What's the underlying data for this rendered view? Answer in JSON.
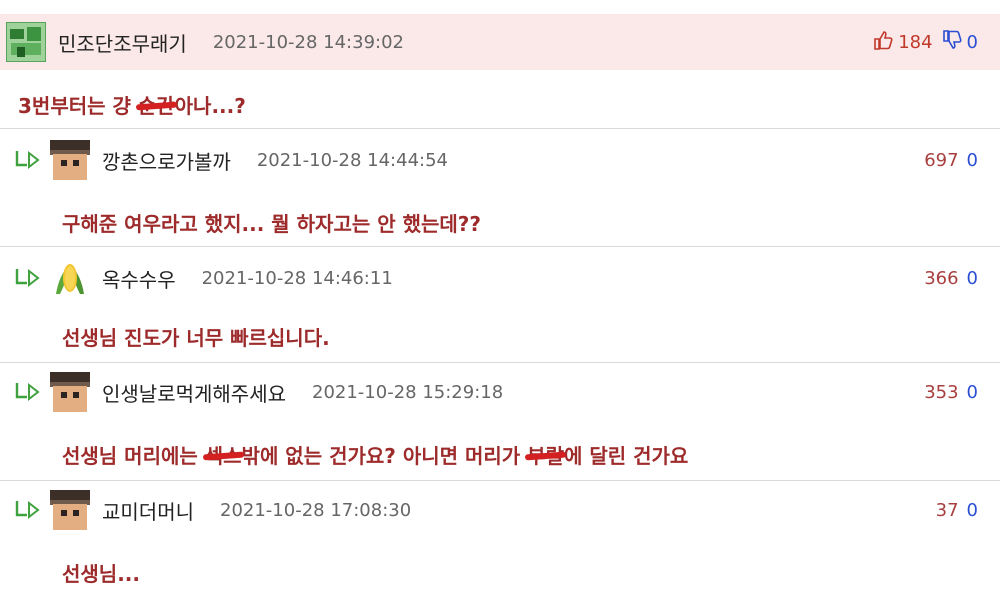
{
  "main_comment": {
    "nickname": "민조단조무래기",
    "timestamp": "2021-10-28 14:39:02",
    "upvotes": "184",
    "downvotes": "0",
    "text": "3번부터는 걍 ",
    "text_redacted": "순간",
    "text_tail": "아나...?"
  },
  "replies": [
    {
      "nickname": "깡촌으로가볼까",
      "timestamp": "2021-10-28 14:44:54",
      "upvotes": "697",
      "downvotes": "0",
      "text": "구해준 여우라고 했지... 뭘 하자고는 안 했는데??",
      "avatar": "block-face"
    },
    {
      "nickname": "옥수수우",
      "timestamp": "2021-10-28 14:46:11",
      "upvotes": "366",
      "downvotes": "0",
      "text": "선생님 진도가 너무 빠르십니다.",
      "avatar": "corn"
    },
    {
      "nickname": "인생날로먹게해주세요",
      "timestamp": "2021-10-28 15:29:18",
      "upvotes": "353",
      "downvotes": "0",
      "text_a": "선생님 머리에는 ",
      "text_redacted_a": "섹스",
      "text_b": "밖에 없는 건가요? 아니면 머리가 ",
      "text_redacted_b": "부랄",
      "text_c": "에 달린 건가요",
      "avatar": "block-face"
    },
    {
      "nickname": "교미더머니",
      "timestamp": "2021-10-28 17:08:30",
      "upvotes": "37",
      "downvotes": "0",
      "text": "선생님...",
      "avatar": "block-face"
    }
  ],
  "icons": {
    "thumbs_up": "thumbs-up-icon",
    "thumbs_down": "thumbs-down-icon",
    "reply": "reply-arrow-icon"
  },
  "colors": {
    "highlight_bg": "#fbe9e9",
    "comment_text": "#9e2b2b",
    "upvote": "#c0392b",
    "downvote": "#2b4fd3",
    "reply_arrow": "#3fa23f"
  }
}
